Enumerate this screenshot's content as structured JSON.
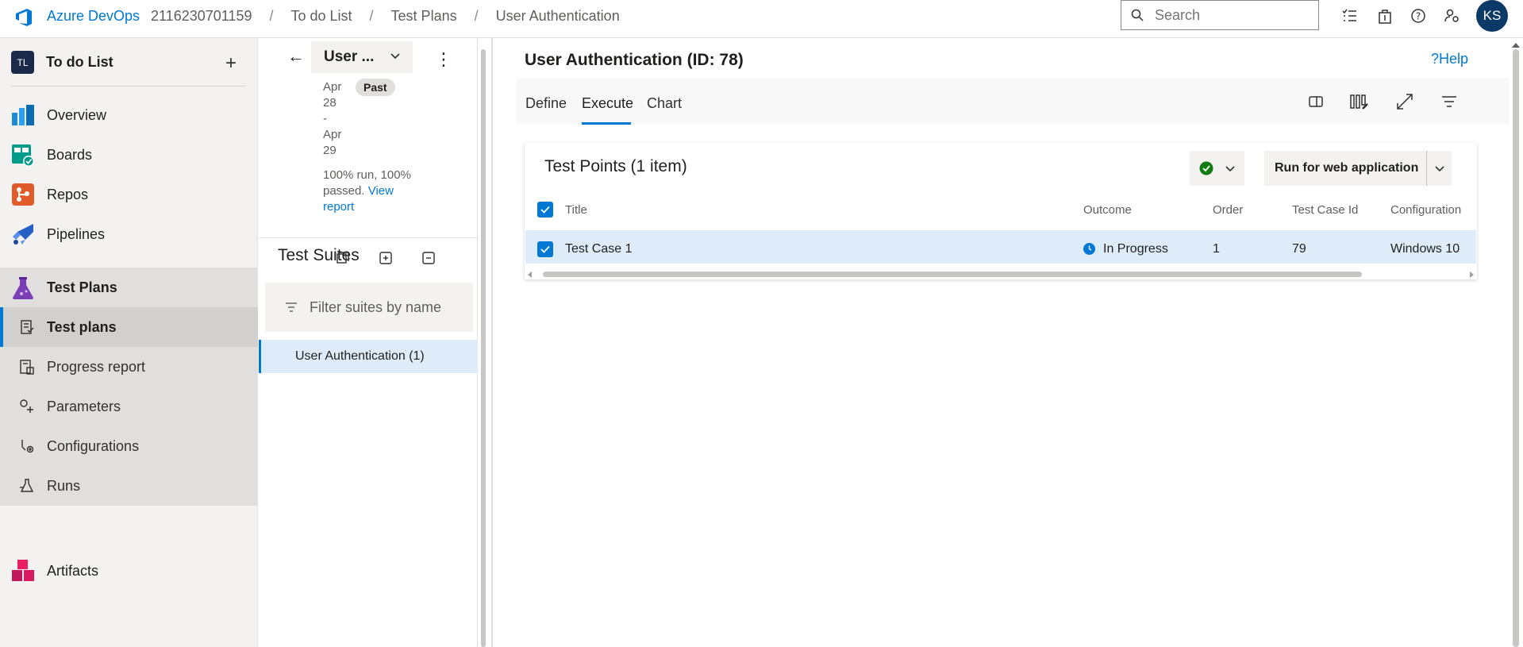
{
  "header": {
    "brand": "Azure DevOps",
    "breadcrumbs": [
      "2116230701159",
      "To do List",
      "Test Plans",
      "User Authentication"
    ],
    "search_placeholder": "Search",
    "avatar_initials": "KS"
  },
  "sidebar": {
    "project_badge": "TL",
    "project_name": "To do List",
    "items": [
      {
        "label": "Overview",
        "icon": "overview-icon"
      },
      {
        "label": "Boards",
        "icon": "boards-icon"
      },
      {
        "label": "Repos",
        "icon": "repos-icon"
      },
      {
        "label": "Pipelines",
        "icon": "pipelines-icon"
      },
      {
        "label": "Test Plans",
        "icon": "test-plans-icon"
      },
      {
        "label": "Test plans",
        "icon": "test-plans-sub-icon"
      },
      {
        "label": "Progress report",
        "icon": "progress-report-icon"
      },
      {
        "label": "Parameters",
        "icon": "parameters-icon"
      },
      {
        "label": "Configurations",
        "icon": "configurations-icon"
      },
      {
        "label": "Runs",
        "icon": "runs-icon"
      },
      {
        "label": "Artifacts",
        "icon": "artifacts-icon"
      }
    ]
  },
  "plan": {
    "name": "User ...",
    "date_lines": [
      "Apr",
      "28",
      "-",
      "Apr",
      "29"
    ],
    "status_badge": "Past",
    "summary": "100% run, 100% passed.",
    "report_link": "View report",
    "suites_title": "Test Suites",
    "filter_placeholder": "Filter suites by name",
    "suite_item": "User Authentication (1)"
  },
  "main": {
    "title": "User Authentication (ID: 78)",
    "help": "?Help",
    "tabs": [
      "Define",
      "Execute",
      "Chart"
    ],
    "active_tab": "Execute",
    "card_title": "Test Points (1 item)",
    "run_button": "Run for web application",
    "columns": [
      "Title",
      "Outcome",
      "Order",
      "Test Case Id",
      "Configuration"
    ],
    "rows": [
      {
        "title": "Test Case 1",
        "outcome": "In Progress",
        "order": "1",
        "test_case_id": "79",
        "configuration": "Windows 10"
      }
    ],
    "colors": {
      "accent": "#0078d4",
      "passed": "#107c10",
      "selected_row": "#deecf9"
    }
  }
}
